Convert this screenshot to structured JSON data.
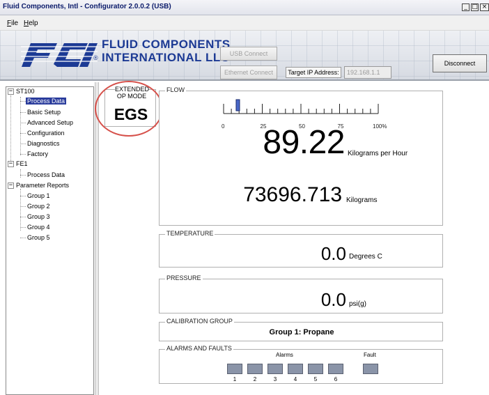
{
  "window": {
    "title": "Fluid Components, Intl - Configurator 2.0.0.2 (USB)",
    "controls": [
      "minimize-icon",
      "maximize-icon",
      "close-icon"
    ]
  },
  "menu": {
    "file": {
      "accel": "F",
      "rest": "ile"
    },
    "help": {
      "accel": "H",
      "rest": "elp"
    }
  },
  "header": {
    "logo_line1": "FLUID COMPONENTS",
    "logo_line2": "INTERNATIONAL LLC",
    "logo_reg": "®",
    "usb_connect": "USB Connect",
    "ethernet_connect": "Ethernet Connect",
    "target_ip_label": "Target IP Address:",
    "target_ip_value": "192.168.1.1",
    "disconnect": "Disconnect"
  },
  "tree": {
    "nodes": {
      "st100": "ST100",
      "process_data": "Process Data",
      "basic_setup": "Basic Setup",
      "advanced_setup": "Advanced Setup",
      "configuration": "Configuration",
      "diagnostics": "Diagnostics",
      "factory": "Factory",
      "fe1": "FE1",
      "fe1_process_data": "Process Data",
      "parameter_reports": "Parameter Reports",
      "group1": "Group 1",
      "group2": "Group 2",
      "group3": "Group 3",
      "group4": "Group 4",
      "group5": "Group 5"
    },
    "expander_symbol": "−",
    "selected": "Process Data"
  },
  "op_mode": {
    "label_line1": "EXTENDED",
    "label_line2": "OP MODE",
    "value": "EGS",
    "highlight_color": "#d6504a"
  },
  "flow": {
    "label": "FLOW",
    "scale_ticks": [
      "0",
      "25",
      "50",
      "75",
      "100%"
    ],
    "indicator_percent": 9,
    "rate_value": "89.22",
    "rate_unit": "Kilograms per Hour",
    "total_value": "73696.713",
    "total_unit": "Kilograms"
  },
  "temperature": {
    "label": "TEMPERATURE",
    "value": "0.0",
    "unit": "Degrees C"
  },
  "pressure": {
    "label": "PRESSURE",
    "value": "0.0",
    "unit": "psi(g)"
  },
  "calibration": {
    "label": "CALIBRATION GROUP",
    "value": "Group 1: Propane"
  },
  "alarms": {
    "label": "ALARMS AND FAULTS",
    "alarms_title": "Alarms",
    "fault_title": "Fault",
    "alarm_numbers": [
      "1",
      "2",
      "3",
      "4",
      "5",
      "6"
    ],
    "led_color": "#8a94a8"
  }
}
